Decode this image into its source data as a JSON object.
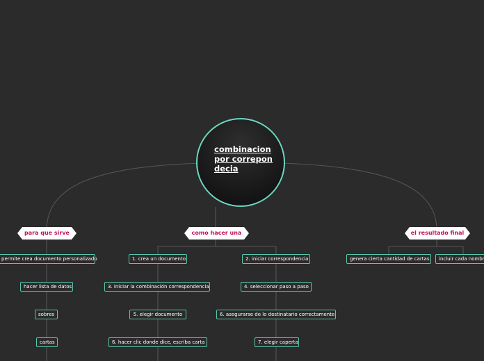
{
  "central": {
    "title": "combinacion por correpondecia"
  },
  "branches": {
    "left": {
      "title": "para que sirve",
      "items": [
        "permite crea documento personalizado",
        "hacer lista de datos",
        "sobres",
        "cartas"
      ]
    },
    "center": {
      "title": "como hacer una",
      "items_left": [
        "1. crea un documento",
        "3. iniciar la combinación correspondencia",
        "5. elegir documento",
        "6. hacer clic donde dice, escriba carta"
      ],
      "items_right": [
        "2. iniciar correspondencia",
        "4. seleccionar paso a paso",
        "6. asegurarse de lo destinatario correctamente",
        "7. elegir caperta"
      ]
    },
    "right": {
      "title": "el resultado final",
      "items": [
        "genera cierta cantidad de cartas",
        "incluir cada nombre"
      ]
    }
  },
  "colors": {
    "background": "#2b2b2b",
    "central_border": "#69d9c0",
    "topic_text": "#c0135a",
    "subtopic_border": "#58c9ae",
    "connector": "#555555"
  }
}
